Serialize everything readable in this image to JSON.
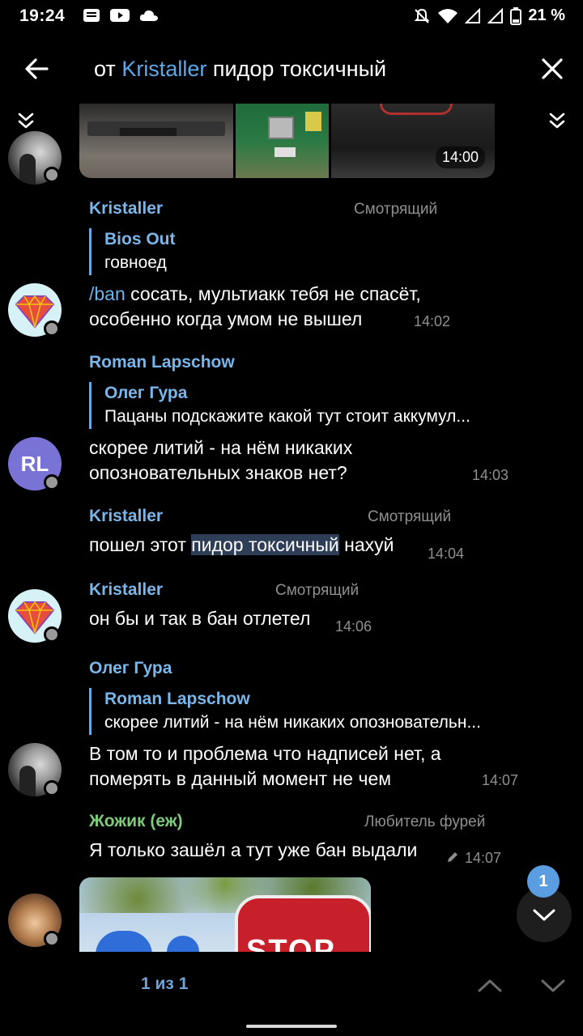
{
  "status": {
    "time": "19:24",
    "battery": "21 %"
  },
  "header": {
    "prefix": "от",
    "username": "Kristaller",
    "query": "пидор токсичный"
  },
  "photo_time": "14:00",
  "messages": [
    {
      "author": "Kristaller",
      "role": "Смотрящий",
      "reply_author": "Bios Out",
      "reply_text": "говноед",
      "cmd": "/ban",
      "line1_rest": " сосать, мультиакк тебя не спасёт,",
      "line2": "особенно когда умом не вышел",
      "time": "14:02"
    },
    {
      "author": "Roman Lapschow",
      "initials": "RL",
      "reply_author": "Олег Гура",
      "reply_text": "Пацаны подскажите какой тут стоит аккумул...",
      "line1": "скорее литий - на нём никаких",
      "line2": "опозновательных знаков нет?",
      "time": "14:03"
    },
    {
      "author": "Kristaller",
      "role": "Смотрящий",
      "pre": "пошел этот ",
      "highlight": "пидор токсичный",
      "post": " нахуй",
      "time": "14:04"
    },
    {
      "author": "Kristaller",
      "role": "Смотрящий",
      "text": "он бы и так в бан отлетел",
      "time": "14:06"
    },
    {
      "author": "Олег Гура",
      "reply_author": "Roman Lapschow",
      "reply_text": "скорее литий - на нём никаких опозновательн...",
      "line1": "В том то и проблема что надписей нет, а",
      "line2": "померять в данный момент не чем",
      "time": "14:07"
    },
    {
      "author": "Жожик (еж)",
      "role": "Любитель фурей",
      "text": "Я только зашёл а тут уже бан выдали",
      "time": "14:07"
    }
  ],
  "stop_sign_text": "STOP",
  "fab_badge": "1",
  "footer": {
    "counter": "1 из 1"
  },
  "colors": {
    "accent": "#5fa8e8",
    "author": "#7ab6ea",
    "green_author": "#7fcb7c",
    "highlight": "#2e3e57"
  }
}
